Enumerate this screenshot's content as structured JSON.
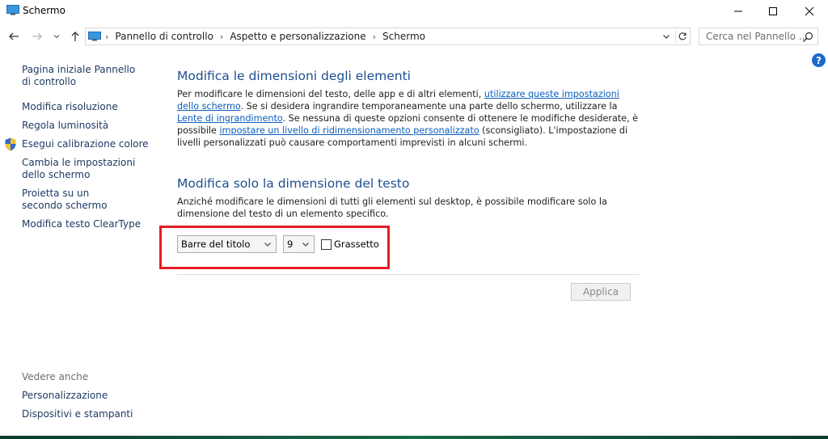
{
  "window": {
    "title": "Schermo",
    "minimize_glyph": "—",
    "maximize_glyph": "☐",
    "close_glyph": "✕"
  },
  "nav": {
    "back_icon": "back-arrow-icon",
    "forward_icon": "forward-arrow-icon",
    "recent_icon": "chevron-down-icon",
    "up_icon": "up-arrow-icon"
  },
  "address": {
    "crumbs": [
      "Pannello di controllo",
      "Aspetto e personalizzazione",
      "Schermo"
    ]
  },
  "search": {
    "placeholder": "Cerca nel Pannello ..."
  },
  "help": {
    "glyph": "?"
  },
  "sidebar": {
    "home": "Pagina iniziale Pannello di controllo",
    "items": [
      "Modifica risoluzione",
      "Regola luminosità",
      "Esegui calibrazione colore",
      "Cambia le impostazioni dello schermo",
      "Proietta su un secondo schermo",
      "Modifica testo ClearType"
    ],
    "see_also_label": "Vedere anche",
    "see_also": [
      "Personalizzazione",
      "Dispositivi e stampanti"
    ]
  },
  "main": {
    "heading1": "Modifica le dimensioni degli elementi",
    "para1_parts": [
      "Per modificare le dimensioni del testo, delle app e di altri elementi, ",
      "utilizzare queste impostazioni dello schermo",
      ". Se si desidera ingrandire temporaneamente una parte dello schermo, utilizzare la ",
      "Lente di ingrandimento",
      ". Se nessuna di queste opzioni consente di ottenere le modifiche desiderate, è possibile ",
      "impostare un livello di ridimensionamento personalizzato",
      " (sconsigliato). L'impostazione di livelli personalizzati può causare comportamenti imprevisti in alcuni schermi."
    ],
    "heading2": "Modifica solo la dimensione del testo",
    "para2": "Anziché modificare le dimensioni di tutti gli elementi sul desktop, è possibile modificare solo la dimensione del testo di un elemento specifico.",
    "element_select": "Barre del titolo",
    "size_select": "9",
    "bold_label": "Grassetto",
    "bold_checked": false,
    "apply_label": "Applica"
  },
  "colors": {
    "heading": "#1e4f91",
    "link": "#0b5ebd",
    "highlight": "#e31c23"
  }
}
